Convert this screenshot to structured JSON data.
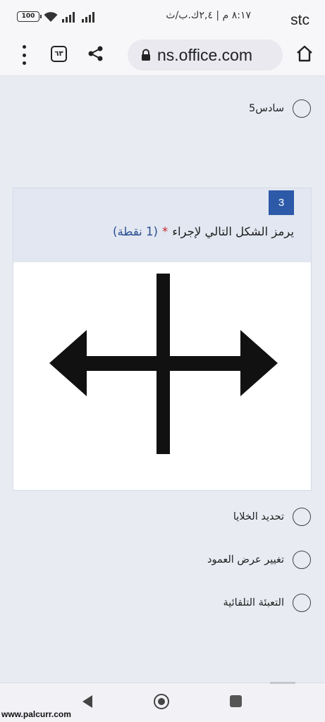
{
  "status_bar": {
    "carrier": "stc",
    "time_text": "٨:١٧ م | ٢,٤ك.ب/ث",
    "battery": "100",
    "icons": [
      "battery-icon",
      "wifi-icon",
      "signal-icon",
      "signal-icon"
    ]
  },
  "browser": {
    "url": "ns.office.com",
    "tab_count": "٦٣",
    "icons": [
      "menu-dots-icon",
      "tabs-icon",
      "share-icon",
      "lock-icon",
      "home-icon"
    ]
  },
  "previous_question": {
    "option_label": "سادس5"
  },
  "question": {
    "number": "3",
    "title": "يرمز الشكل التالي لإجراء",
    "required_mark": "*",
    "points": "(1 نقطة)",
    "image_icon": "column-resize-arrow-icon",
    "options": [
      {
        "label": "تحديد الخلايا"
      },
      {
        "label": "تغيير عرض العمود"
      },
      {
        "label": "التعبئة التلقائية"
      }
    ]
  },
  "colors": {
    "question_number_bg": "#2d5aa8",
    "required": "#c4262e",
    "points": "#2b4f92",
    "page_bg": "#e8ebf2",
    "question_header_bg": "#e2e7f1"
  },
  "nav_bar": {
    "icons": [
      "back-icon",
      "home-button-icon",
      "recents-icon"
    ]
  },
  "watermark": "www.palcurr.com"
}
